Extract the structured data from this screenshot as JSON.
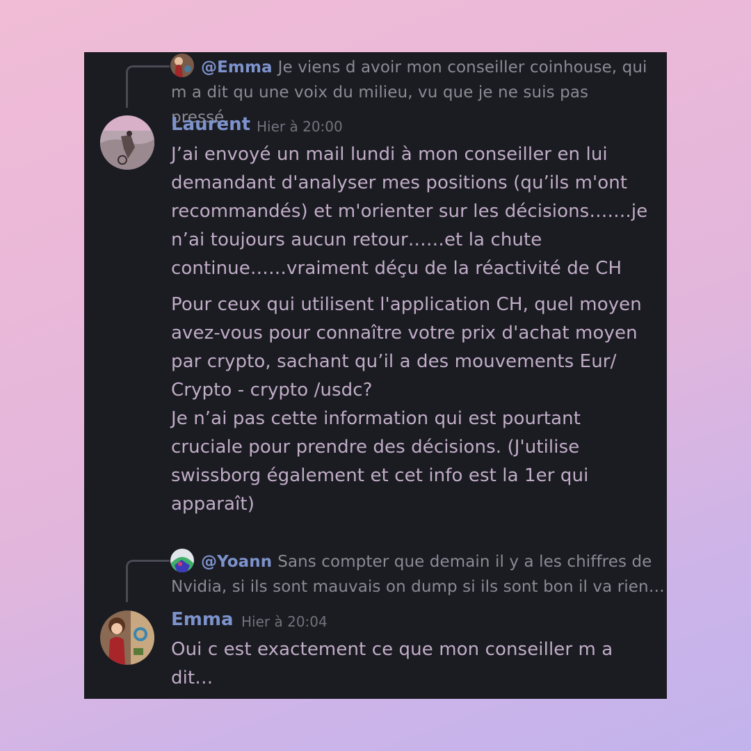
{
  "messages": {
    "laurent_reply": {
      "mention": "@Emma",
      "line1": "Je viens d avoir mon conseiller coinhouse, qui",
      "line2": "m a dit qu une voix du milieu, vu que je ne suis pas pressé…"
    },
    "laurent": {
      "author": "Laurent",
      "timestamp": "Hier à 20:00",
      "paragraph1": [
        "J’ai envoyé un mail lundi à mon conseiller en lui",
        "demandant d'analyser mes positions (qu’ils m'ont",
        "recommandés) et m'orienter sur les décisions…….je",
        "n’ai toujours aucun retour……et la chute",
        "continue……vraiment déçu de la réactivité de CH"
      ],
      "paragraph2": [
        "Pour ceux qui utilisent l'application CH, quel moyen",
        "avez-vous pour connaître votre prix d'achat moyen",
        "par crypto, sachant qu’il a des mouvements Eur/",
        "Crypto - crypto /usdc?",
        "Je n’ai pas cette information qui est pourtant",
        "cruciale pour prendre des décisions. (J'utilise",
        "swissborg également et cet info est la 1er qui",
        "apparaît)"
      ]
    },
    "emma_reply": {
      "mention": "@Yoann",
      "line1": "Sans compter que demain il y a les chiffres de",
      "line2": "Nvidia, si ils sont mauvais on dump si ils sont bon il va rien…"
    },
    "emma": {
      "author": "Emma",
      "timestamp": "Hier à 20:04",
      "lines": [
        "Oui c est exactement ce que mon conseiller m a",
        "dit…"
      ]
    }
  }
}
